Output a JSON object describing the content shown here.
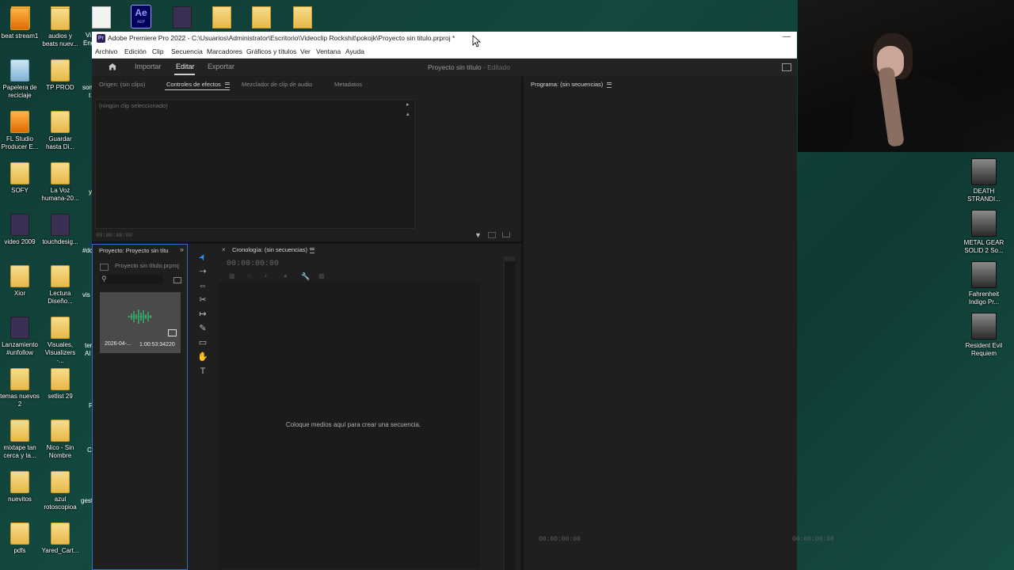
{
  "desktop": {
    "top_icons": [
      {
        "icon": "fl-studio-icon"
      },
      {
        "icon": "folder-icon"
      },
      {
        "icon": "document-icon"
      },
      {
        "icon": "after-effects-icon",
        "text": "Ae",
        "sub": "AEP"
      },
      {
        "icon": "video-file-icon"
      },
      {
        "icon": "folder-icon"
      },
      {
        "icon": "folder-icon"
      },
      {
        "icon": "folder-zip-icon"
      }
    ],
    "left_icons": [
      {
        "label": "beat stream1",
        "icon": "fl-studio-icon"
      },
      {
        "label": "audios y beats nuev...",
        "icon": "folder-icon"
      },
      {
        "label": "Papelera de reciclaje",
        "icon": "recycle-bin-icon"
      },
      {
        "label": "TP PROD",
        "icon": "folder-icon"
      },
      {
        "label": "FL Studio Producer E...",
        "icon": "fl-studio-icon"
      },
      {
        "label": "Guardar hasta Di...",
        "icon": "folder-icon"
      },
      {
        "label": "SOFY",
        "icon": "folder-icon"
      },
      {
        "label": "La Voz humana-20...",
        "icon": "folder-icon"
      },
      {
        "label": "video 2009",
        "icon": "video-file-icon"
      },
      {
        "label": "touchdesig...",
        "icon": "app-icon"
      },
      {
        "label": "Xior",
        "icon": "folder-icon"
      },
      {
        "label": "Lectura Diseño...",
        "icon": "folder-icon"
      },
      {
        "label": "Lanzamiento #unfollow",
        "icon": "video-file-icon"
      },
      {
        "label": "Visuales, Visualizers -...",
        "icon": "folder-icon"
      },
      {
        "label": "temas nuevos 2",
        "icon": "folder-icon"
      },
      {
        "label": "setlist 29",
        "icon": "folder-icon"
      },
      {
        "label": "mixtape tan cerca y ta...",
        "icon": "folder-icon"
      },
      {
        "label": "Nico - Sin Nombre",
        "icon": "folder-icon"
      },
      {
        "label": "nuevitos",
        "icon": "folder-icon"
      },
      {
        "label": "azul rotoscopioa",
        "icon": "folder-icon"
      },
      {
        "label": "pdfs",
        "icon": "folder-icon"
      },
      {
        "label": "Yared_Cart...",
        "icon": "folder-icon"
      }
    ],
    "partial_labels": [
      "Vi",
      "Eng",
      "son",
      "t",
      "y",
      "#dc",
      "vis",
      "ter",
      "Al",
      "F",
      "C",
      "gest"
    ],
    "right_icons": [
      {
        "label": "DEATH STRANDI...",
        "icon": "game-shortcut-icon"
      },
      {
        "label": "METAL GEAR SOLID 2 So...",
        "icon": "game-shortcut-icon"
      },
      {
        "label": "Fahrenheit Indigo Pr...",
        "icon": "game-shortcut-icon"
      },
      {
        "label": "Resident Evil Requiem",
        "icon": "game-shortcut-icon"
      }
    ]
  },
  "window": {
    "title": "Adobe Premiere Pro 2022 - C:\\Usuarios\\Administrator\\Escritorio\\Videoclip Rockshit\\pokojk\\Proyecto sin titulo.prproj *",
    "menu": [
      "Archivo",
      "Edición",
      "Clip",
      "Secuencia",
      "Marcadores",
      "Gráficos y títulos",
      "Ver",
      "Ventana",
      "Ayuda"
    ]
  },
  "header": {
    "tabs": [
      "Importar",
      "Editar",
      "Exportar"
    ],
    "active_tab": "Editar",
    "project_name": "Proyecto sin título",
    "edited": "- Editado"
  },
  "source_panel": {
    "tabs": [
      "Origen: (sin clips)",
      "Controles de efectos",
      "Mezclador de clip de audio",
      "Metadatos"
    ],
    "active_tab": "Controles de efectos",
    "no_clip": "(ningún clip seleccionado)",
    "timecode": "00:00:00:00"
  },
  "program_panel": {
    "tab": "Programa: (sin secuencias)",
    "timecode_left": "00:00:00:00",
    "timecode_right": "00:00:00:00"
  },
  "project_panel": {
    "tab": "Proyecto: Proyecto sin títu",
    "file": "Proyecto sin título.prproj",
    "clip": {
      "name": "2026-04-...",
      "duration": "1:00:53:34220"
    }
  },
  "timeline_panel": {
    "tab": "Cronología: (sin secuencias)",
    "timecode": "00:00:00:00",
    "placeholder": "Coloque medios aquí para crear una secuencia."
  },
  "tools": [
    "selection-tool-icon",
    "track-select-tool-icon",
    "ripple-edit-tool-icon",
    "razor-tool-icon",
    "slip-tool-icon",
    "pen-tool-icon",
    "rectangle-tool-icon",
    "hand-tool-icon",
    "type-tool-icon"
  ],
  "colors": {
    "accent": "#2d8ceb",
    "audio_wave": "#2ecc71",
    "bg": "#1d1d1d"
  }
}
